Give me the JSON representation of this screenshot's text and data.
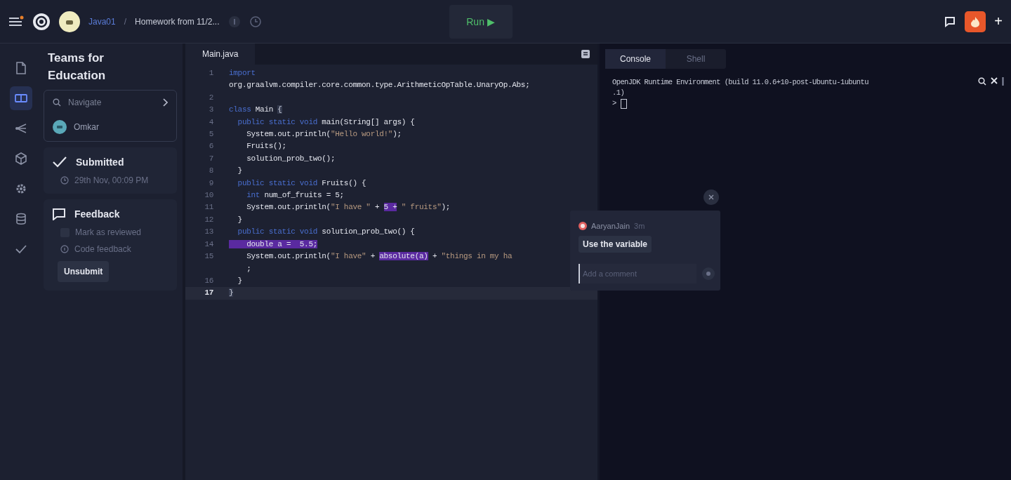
{
  "topbar": {
    "project": "Java01",
    "separator": "/",
    "title": "Homework from 11/2...",
    "run_label": "Run ▶",
    "add_label": "+"
  },
  "rail": [
    {
      "selected": false
    },
    {
      "selected": true
    },
    {
      "selected": false
    },
    {
      "selected": false
    },
    {
      "selected": false
    },
    {
      "selected": false
    },
    {
      "selected": false
    }
  ],
  "panel": {
    "title": "Teams for Education",
    "navigate": {
      "placeholder": "Navigate"
    },
    "user": "Omkar",
    "submission": {
      "status": "Submitted",
      "time": "29th Nov, 00:09 PM"
    },
    "feedback": {
      "title": "Feedback",
      "review": {
        "label": "Mark as reviewed",
        "checked": false
      },
      "code_feedback": "Code feedback",
      "button": "Unsubmit"
    }
  },
  "editor": {
    "tab": "Main.java",
    "lines": [
      {
        "number": "1",
        "current": false,
        "tokens": [
          {
            "kind": "keyword",
            "text": "import"
          }
        ]
      },
      {
        "tokens": [
          {
            "kind": "plain",
            "text": "org.graalvm.compiler.core.common.type.ArithmeticOpTable.UnaryOp.Abs;"
          }
        ]
      },
      {
        "number": "2",
        "current": false
      },
      {
        "number": "3",
        "current": false,
        "tokens": [
          {
            "kind": "keyword",
            "text": "class "
          },
          {
            "kind": "plain",
            "text": "Main "
          },
          {
            "kind": "bracket",
            "text": "{"
          }
        ]
      },
      {
        "number": "4",
        "current": false,
        "tokens": [
          {
            "kind": "keyword",
            "text": "  public static void "
          },
          {
            "kind": "plain",
            "text": "main(String[] args) {"
          }
        ]
      },
      {
        "number": "5",
        "current": false,
        "tokens": [
          {
            "kind": "plain",
            "text": "    System.out.println("
          },
          {
            "kind": "string",
            "text": "\"Hello world!\""
          },
          {
            "kind": "plain",
            "text": ");"
          }
        ]
      },
      {
        "number": "6",
        "current": false,
        "tokens": [
          {
            "kind": "plain",
            "text": "    Fruits();"
          }
        ]
      },
      {
        "number": "7",
        "current": false,
        "tokens": [
          {
            "kind": "plain",
            "text": "    solution_prob_two();"
          }
        ]
      },
      {
        "number": "8",
        "current": false,
        "tokens": [
          {
            "kind": "plain",
            "text": "  }"
          }
        ]
      },
      {
        "number": "9",
        "current": false,
        "tokens": [
          {
            "kind": "keyword",
            "text": "  public static void "
          },
          {
            "kind": "plain",
            "text": "Fruits() {"
          }
        ]
      },
      {
        "number": "10",
        "current": false,
        "tokens": [
          {
            "kind": "keyword",
            "text": "    int "
          },
          {
            "kind": "plain",
            "text": "num_of_fruits = 5;"
          }
        ]
      },
      {
        "number": "11",
        "current": false,
        "tokens": [
          {
            "kind": "plain",
            "text": "    System.out.println("
          },
          {
            "kind": "string",
            "text": "\"I have \""
          },
          {
            "kind": "plain",
            "text": " + "
          },
          {
            "kind": "mark",
            "text": "5 +"
          },
          {
            "kind": "string",
            "text": " \" fruits\""
          },
          {
            "kind": "plain",
            "text": ");"
          }
        ]
      },
      {
        "number": "12",
        "current": false,
        "tokens": [
          {
            "kind": "plain",
            "text": "  }"
          }
        ]
      },
      {
        "number": "13",
        "current": false,
        "tokens": [
          {
            "kind": "keyword",
            "text": "  public static void "
          },
          {
            "kind": "plain",
            "text": "solution_prob_two() {"
          }
        ]
      },
      {
        "number": "14",
        "current": false,
        "tokens": [
          {
            "kind": "mark",
            "text": "    double a =  5.5;"
          }
        ]
      },
      {
        "number": "15",
        "current": false,
        "tokens": [
          {
            "kind": "plain",
            "text": "    System.out.println("
          },
          {
            "kind": "string",
            "text": "\"I have\""
          },
          {
            "kind": "plain",
            "text": " + "
          },
          {
            "kind": "mark",
            "text": "absolute(a)"
          },
          {
            "kind": "plain",
            "text": " + "
          },
          {
            "kind": "string",
            "text": "\"things in my ha"
          }
        ]
      },
      {
        "tokens": [
          {
            "kind": "plain",
            "text": "    ;"
          }
        ]
      },
      {
        "number": "16",
        "current": false,
        "tokens": [
          {
            "kind": "plain",
            "text": "  }"
          }
        ]
      },
      {
        "number": "17",
        "current": true,
        "tokens": [
          {
            "kind": "bracket",
            "text": "}"
          }
        ]
      }
    ]
  },
  "console": {
    "tabs": [
      {
        "label": "Console",
        "selected": true
      },
      {
        "label": "Shell",
        "selected": false
      }
    ],
    "output": [
      "OpenJDK Runtime Environment (build 11.0.6+10-post-Ubuntu-1ubuntu",
      ".1)"
    ],
    "prompt": ">"
  },
  "comment": {
    "author": "AaryanJain",
    "age": "3m",
    "text": "Use the variable",
    "placeholder": "Add a comment"
  }
}
